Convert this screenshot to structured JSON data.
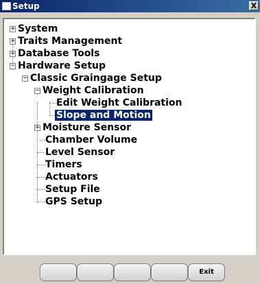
{
  "window": {
    "title": "Setup",
    "close_label": "X"
  },
  "tree": {
    "system": "System",
    "traits_management": "Traits Management",
    "database_tools": "Database Tools",
    "hardware_setup": "Hardware Setup",
    "classic_graingage_setup": "Classic Graingage Setup",
    "weight_calibration": "Weight Calibration",
    "edit_weight_calibration": "Edit Weight Calibration",
    "slope_and_motion": "Slope and Motion",
    "moisture_sensor": "Moisture Sensor",
    "chamber_volume": "Chamber Volume",
    "level_sensor": "Level Sensor",
    "timers": "Timers",
    "actuators": "Actuators",
    "setup_file": "Setup File",
    "gps_setup": "GPS Setup",
    "expand_symbol": "+",
    "collapse_symbol": "−"
  },
  "buttons": {
    "b1": "",
    "b2": "",
    "b3": "",
    "b4": "",
    "exit": "Exit"
  }
}
